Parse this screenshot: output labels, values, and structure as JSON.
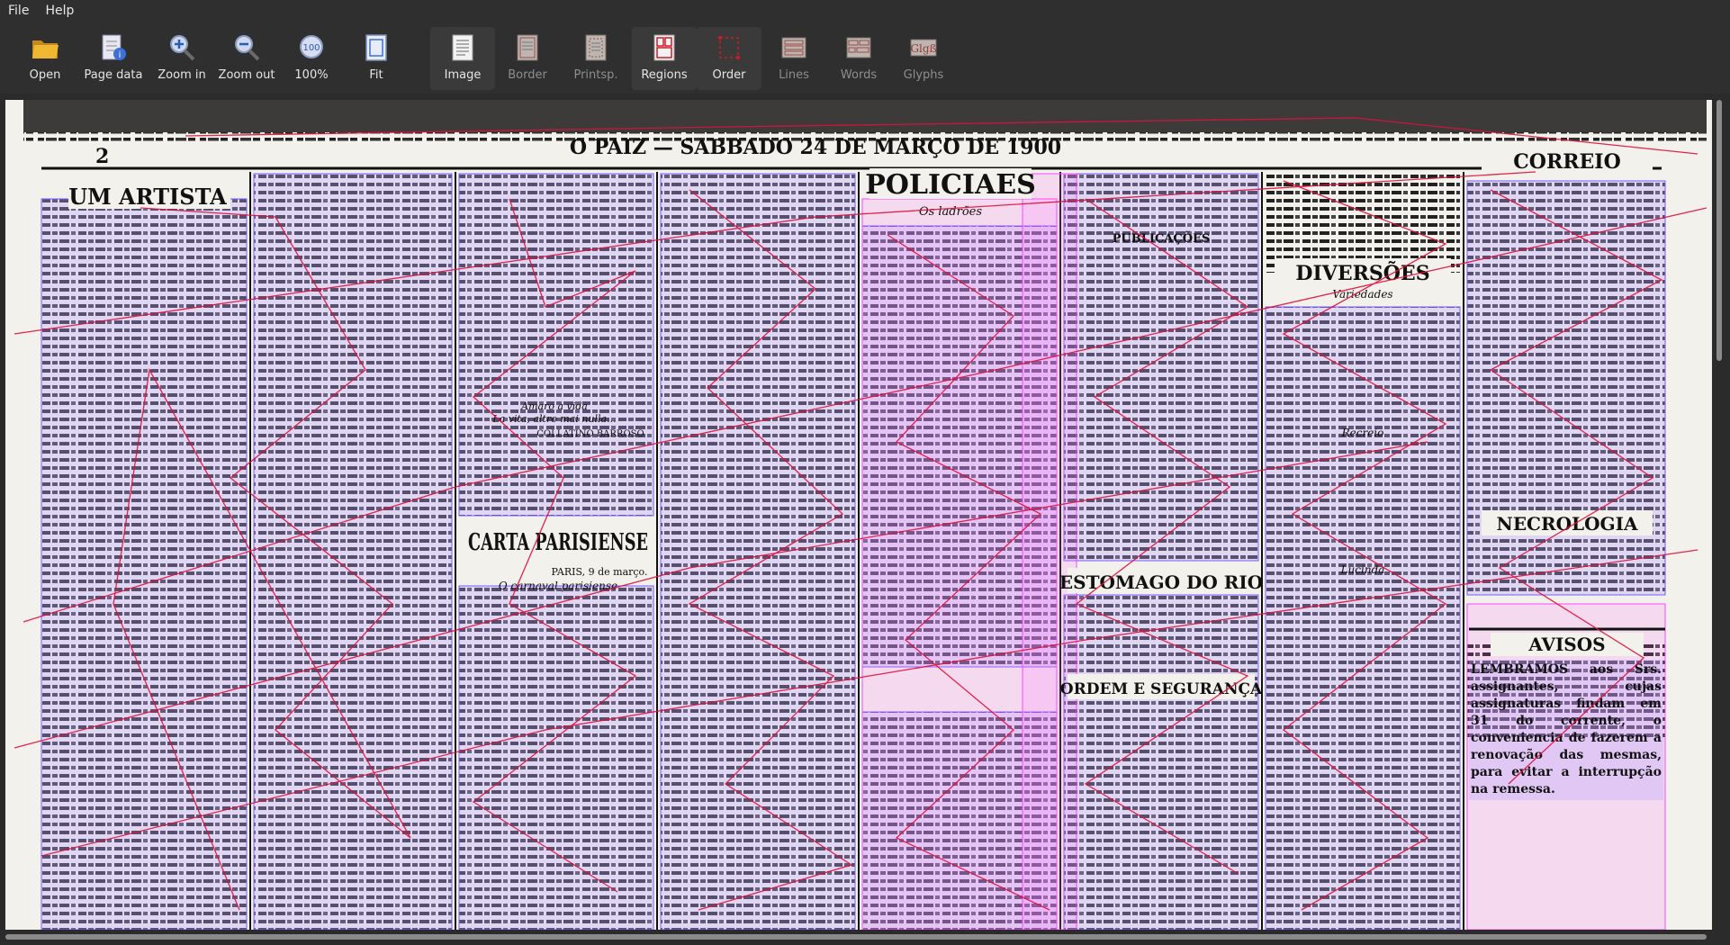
{
  "menu": {
    "file": "File",
    "help": "Help"
  },
  "toolbar": {
    "open": "Open",
    "page_data": "Page data",
    "zoom_in": "Zoom in",
    "zoom_out": "Zoom out",
    "zoom_100": "100%",
    "zoom_100_icon_text": "100",
    "fit": "Fit",
    "image": "Image",
    "border": "Border",
    "printsp": "Printsp.",
    "regions": "Regions",
    "order": "Order",
    "lines": "Lines",
    "words": "Words",
    "glyphs": "Glyphs"
  },
  "document": {
    "page_number": "2",
    "masthead": "O PAIZ — SABBADO 24 DE MARÇO DE 1900",
    "col1_title": "UM ARTISTA",
    "policiaes_title": "POLICIAES",
    "os_ladroes": "Os ladrões",
    "carta_parisiense": "CARTA PARISIENSE",
    "paris_date": "PARIS, 9 de março.",
    "o_carnaval": "O carnaval parisiense",
    "estomago": "ESTOMAGO DO RIO",
    "ordem": "ORDEM E SEGURANÇA",
    "publicacoes": "PUBLICAÇÕES",
    "diversoes": "DIVERSÕES",
    "variedades": "Variedades",
    "recreio": "Recreio",
    "lucinda": "Lucinda",
    "correio": "CORREIO",
    "necrologia": "NECROLOGIA",
    "avisos": "AVISOS",
    "lembramos": "LEMBRAMOS aos Srs. assignantes, cujas assignaturas findam em 31 do corrente, o conveniencia de fazerem a renovação das mesmas, para evitar a interrupção na remessa.",
    "collatino": "COLLATINO BARROSO",
    "amaro": "Amaro a vida",
    "la_vita": "La vita, altro mai nulla..."
  },
  "colors": {
    "background": "#2b2b2b",
    "toolbar": "#2f2f2f",
    "paper": "#f3f1ec",
    "region_fill": "#c9b6ff",
    "region_stroke": "#7a5cff",
    "order_line": "#e0103a",
    "magenta_region": "#ff77ff"
  }
}
